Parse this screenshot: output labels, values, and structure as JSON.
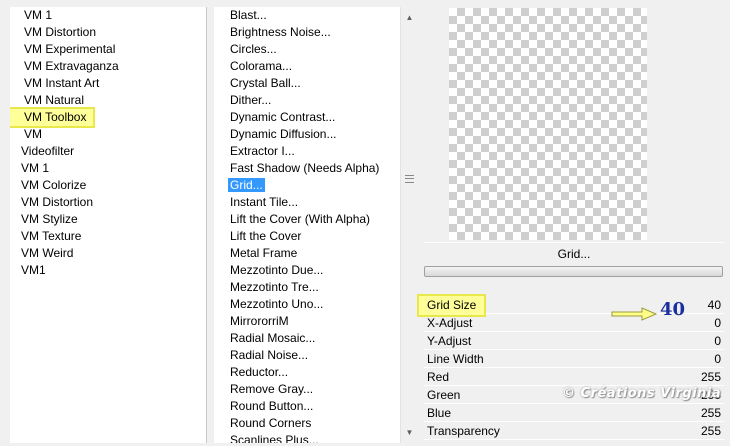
{
  "filter_categories": {
    "items": [
      {
        "label": "VM 1",
        "highlighted": false,
        "outdent": false
      },
      {
        "label": "VM Distortion",
        "highlighted": false,
        "outdent": false
      },
      {
        "label": "VM Experimental",
        "highlighted": false,
        "outdent": false
      },
      {
        "label": "VM Extravaganza",
        "highlighted": false,
        "outdent": false
      },
      {
        "label": "VM Instant Art",
        "highlighted": false,
        "outdent": false
      },
      {
        "label": "VM Natural",
        "highlighted": false,
        "outdent": false
      },
      {
        "label": "VM Toolbox",
        "highlighted": true,
        "outdent": false
      },
      {
        "label": "VM",
        "highlighted": false,
        "outdent": false
      },
      {
        "label": "Videofilter",
        "highlighted": false,
        "outdent": true
      },
      {
        "label": "VM 1",
        "highlighted": false,
        "outdent": true
      },
      {
        "label": "VM Colorize",
        "highlighted": false,
        "outdent": true
      },
      {
        "label": "VM Distortion",
        "highlighted": false,
        "outdent": true
      },
      {
        "label": "VM Stylize",
        "highlighted": false,
        "outdent": true
      },
      {
        "label": "VM Texture",
        "highlighted": false,
        "outdent": true
      },
      {
        "label": "VM Weird",
        "highlighted": false,
        "outdent": true
      },
      {
        "label": "VM1",
        "highlighted": false,
        "outdent": true
      }
    ]
  },
  "filters": {
    "selected": "Grid...",
    "items": [
      "Blast...",
      "Brightness Noise...",
      "Circles...",
      "Colorama...",
      "Crystal Ball...",
      "Dither...",
      "Dynamic Contrast...",
      "Dynamic Diffusion...",
      "Extractor I...",
      "Fast Shadow (Needs Alpha)",
      "Grid...",
      "Instant Tile...",
      "Lift the Cover (With Alpha)",
      "Lift the Cover",
      "Metal Frame",
      "Mezzotinto Due...",
      "Mezzotinto Tre...",
      "Mezzotinto Uno...",
      "MirrororriM",
      "Radial Mosaic...",
      "Radial Noise...",
      "Reductor...",
      "Remove Gray...",
      "Round Button...",
      "Round Corners",
      "Scanlines Plus..."
    ]
  },
  "scrollbar": {
    "up_icon": "▲",
    "down_icon": "▼"
  },
  "preview": {
    "filter_name": "Grid..."
  },
  "parameters": [
    {
      "name": "Grid Size",
      "value": "40"
    },
    {
      "name": "X-Adjust",
      "value": "0"
    },
    {
      "name": "Y-Adjust",
      "value": "0"
    },
    {
      "name": "Line Width",
      "value": "0"
    },
    {
      "name": "Red",
      "value": "255"
    },
    {
      "name": "Green",
      "value": "255"
    },
    {
      "name": "Blue",
      "value": "255"
    },
    {
      "name": "Transparency",
      "value": "255"
    }
  ],
  "annotation": {
    "value": "40"
  },
  "watermark": "© Créations Virginia",
  "colors": {
    "selection": "#3399ff",
    "highlight_box": "#ffff99",
    "highlight_border": "#e8e84a",
    "annotation_text": "#1a2fa0"
  }
}
